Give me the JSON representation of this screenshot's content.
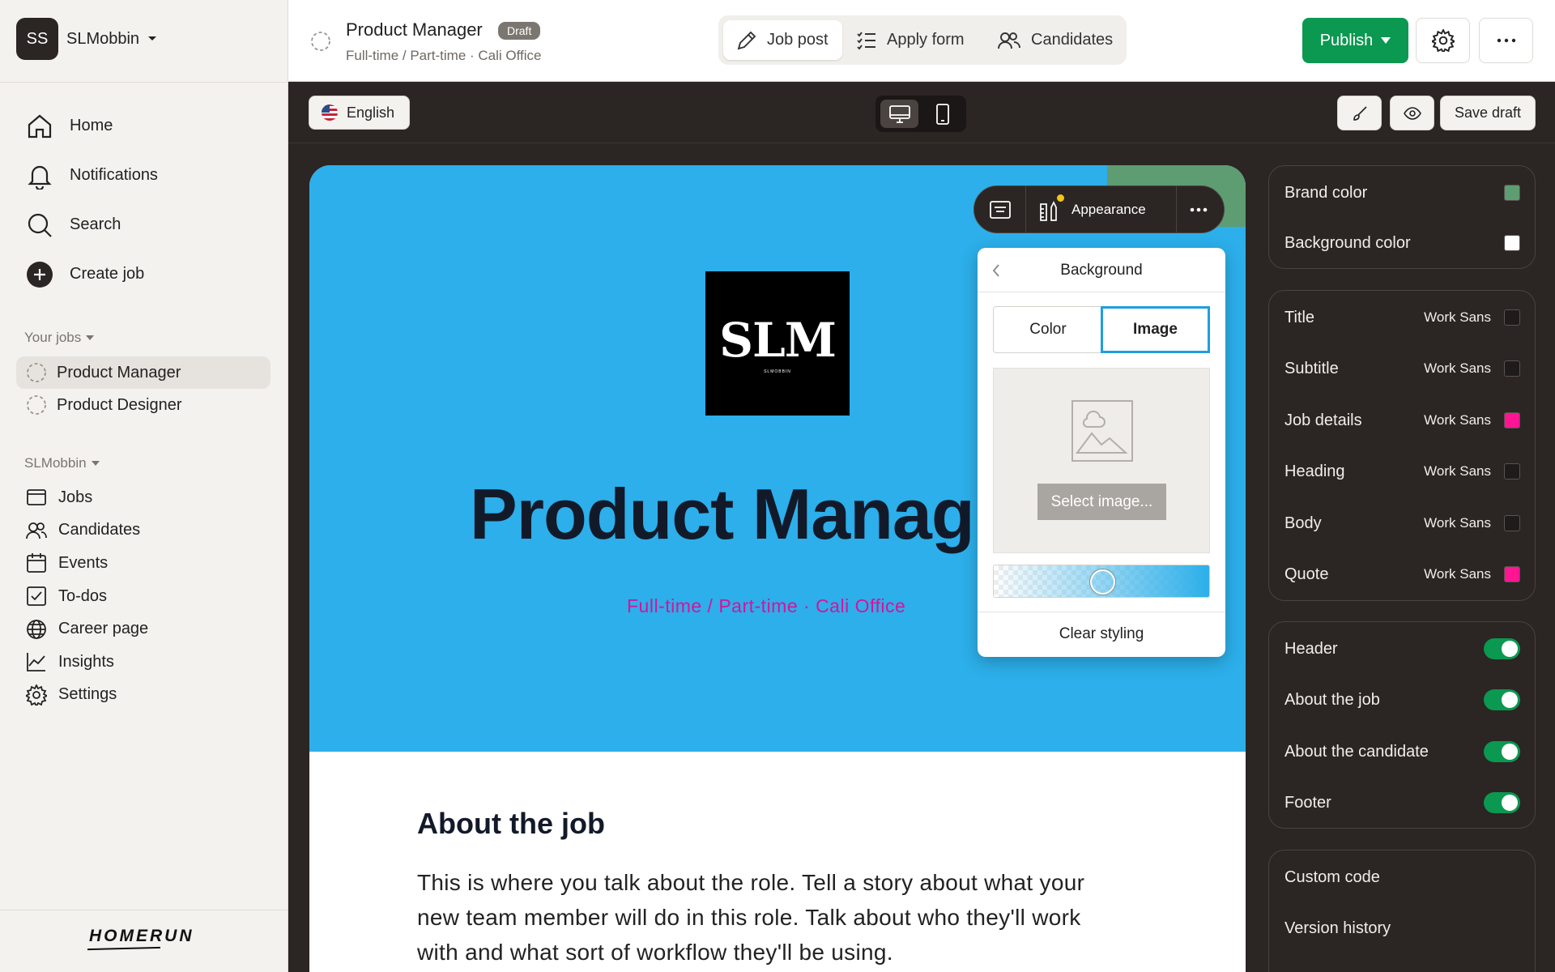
{
  "colors": {
    "accent_green": "#0b9850",
    "hero_bg": "#2cafea",
    "subtitle_pink": "#d8129a",
    "dark_bg": "#2b2523"
  },
  "sidebar": {
    "workspace": {
      "initials": "SS",
      "name": "SLMobbin"
    },
    "main_nav": [
      {
        "icon": "home-icon",
        "label": "Home"
      },
      {
        "icon": "bell-icon",
        "label": "Notifications"
      },
      {
        "icon": "search-icon",
        "label": "Search"
      },
      {
        "icon": "plus-circle-icon",
        "label": "Create job"
      }
    ],
    "your_jobs_title": "Your jobs",
    "jobs": [
      {
        "label": "Product Manager",
        "active": true
      },
      {
        "label": "Product Designer",
        "active": false
      }
    ],
    "workspace_section_title": "SLMobbin",
    "sub_nav": [
      {
        "icon": "jobs-icon",
        "label": "Jobs"
      },
      {
        "icon": "candidates-icon",
        "label": "Candidates"
      },
      {
        "icon": "calendar-icon",
        "label": "Events"
      },
      {
        "icon": "checkbox-icon",
        "label": "To-dos"
      },
      {
        "icon": "globe-icon",
        "label": "Career page"
      },
      {
        "icon": "chart-icon",
        "label": "Insights"
      },
      {
        "icon": "gear-icon",
        "label": "Settings"
      }
    ],
    "logo": "HOMERUN"
  },
  "header": {
    "job_title": "Product Manager",
    "badge": "Draft",
    "meta": "Full-time / Part-time · Cali Office",
    "tabs": [
      {
        "icon": "pencil-icon",
        "label": "Job post",
        "active": true
      },
      {
        "icon": "checklist-icon",
        "label": "Apply form",
        "active": false
      },
      {
        "icon": "candidates-icon",
        "label": "Candidates",
        "active": false
      }
    ],
    "publish_label": "Publish"
  },
  "toolbar": {
    "language": "English",
    "device": "desktop",
    "save_draft": "Save draft"
  },
  "preview": {
    "logo_text": "SLM",
    "logo_small": "SLMOBBIN",
    "title": "Product Manag",
    "subtitle": "Full-time / Part-time · Cali Office",
    "about_heading": "About the job",
    "about_body": "This is where you talk about the role. Tell a story about what your new team member will do in this role. Talk about who they'll work with and what sort of workflow they'll be using."
  },
  "floating_toolbar": {
    "appearance_label": "Appearance"
  },
  "background_popover": {
    "title": "Background",
    "tabs": [
      {
        "label": "Color",
        "active": false
      },
      {
        "label": "Image",
        "active": true
      }
    ],
    "select_image": "Select image...",
    "opacity": 0.5,
    "clear": "Clear styling"
  },
  "style_panel": {
    "colors": [
      {
        "label": "Brand color",
        "swatch": "#5e9c72"
      },
      {
        "label": "Background color",
        "swatch": "#ffffff"
      }
    ],
    "typography": [
      {
        "label": "Title",
        "font": "Work Sans",
        "swatch": "#1f1b1a"
      },
      {
        "label": "Subtitle",
        "font": "Work Sans",
        "swatch": "#1f1b1a"
      },
      {
        "label": "Job details",
        "font": "Work Sans",
        "swatch": "#ff1493"
      },
      {
        "label": "Heading",
        "font": "Work Sans",
        "swatch": "#1f1b1a"
      },
      {
        "label": "Body",
        "font": "Work Sans",
        "swatch": "#1f1b1a"
      },
      {
        "label": "Quote",
        "font": "Work Sans",
        "swatch": "#ff1493"
      }
    ],
    "sections": [
      {
        "label": "Header",
        "on": true
      },
      {
        "label": "About the job",
        "on": true
      },
      {
        "label": "About the candidate",
        "on": true
      },
      {
        "label": "Footer",
        "on": true
      }
    ],
    "links": [
      {
        "label": "Custom code"
      },
      {
        "label": "Version history"
      }
    ]
  }
}
